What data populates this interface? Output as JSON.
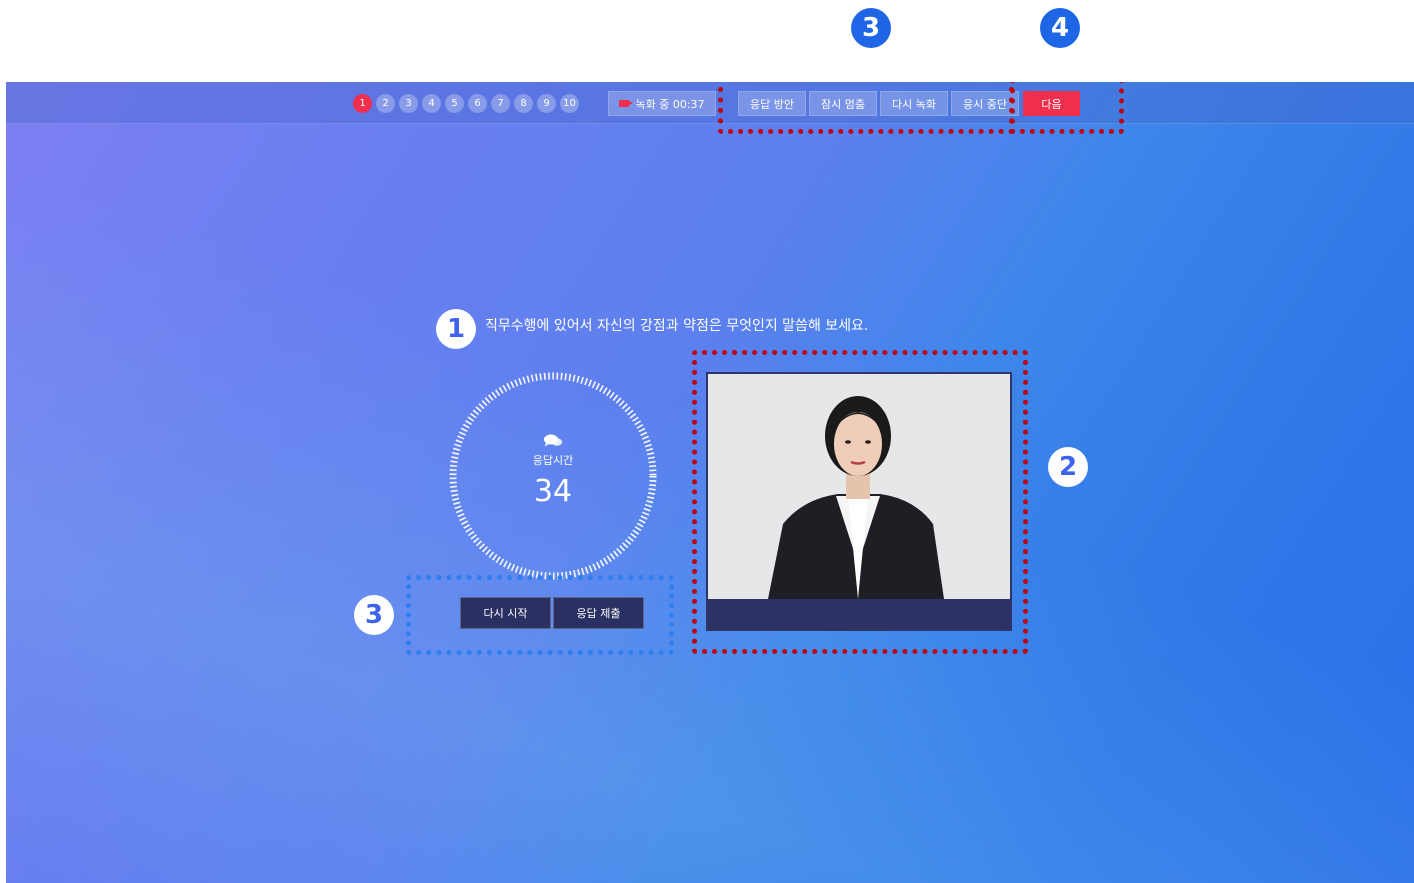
{
  "annotations": {
    "badge_top_3": "3",
    "badge_top_4": "4",
    "badge_question": "1",
    "badge_video": "2",
    "badge_actions": "3"
  },
  "topbar": {
    "steps": [
      "1",
      "2",
      "3",
      "4",
      "5",
      "6",
      "7",
      "8",
      "9",
      "10"
    ],
    "active_step": "1",
    "recording_label": "녹화 중 00:37",
    "buttons": {
      "answer_guide": "응답 방안",
      "pause": "잠시 멈춤",
      "re_record": "다시 녹화",
      "stop_test": "응시 중단",
      "next": "다음"
    }
  },
  "main": {
    "question": "직무수행에 있어서 자신의 강점과 약점은 무엇인지 말씀해 보세요.",
    "timer": {
      "icon": "chat-bubbles-icon",
      "label": "응답시간",
      "value": "34"
    },
    "actions": {
      "restart": "다시 시작",
      "submit": "응답 제출"
    }
  },
  "colors": {
    "accent_red": "#ef2f4d",
    "dark_button": "#2a3062",
    "annotation_red": "#c0000a",
    "annotation_blue": "#2e7ef0"
  }
}
